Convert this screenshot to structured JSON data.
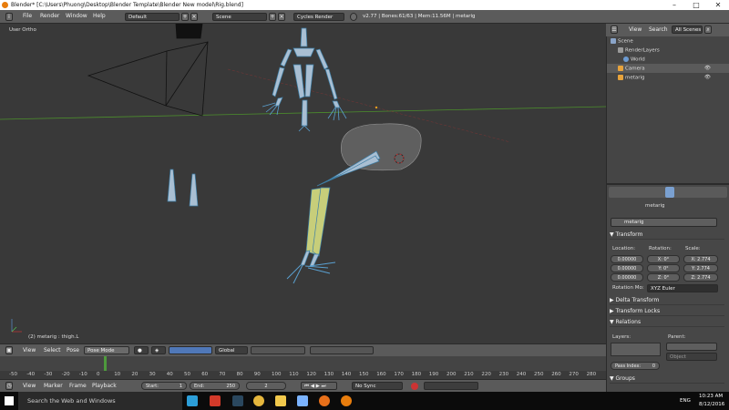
{
  "window": {
    "title": "Blender* [C:\\Users\\Phuong\\Desktop\\Blender Template\\Blender New model\\Rig.blend]",
    "minimize": "–",
    "maximize": "□",
    "close": "✕"
  },
  "menubar": {
    "items": [
      "File",
      "Render",
      "Window",
      "Help"
    ],
    "screen_layout": "Default",
    "scene": "Scene",
    "engine": "Cycles Render",
    "stats": "v2.77 | Bones:61/63 | Mem:11.56M | metarig"
  },
  "viewport": {
    "view_label": "User Ortho",
    "object_label": "(2) metarig : thigh.L"
  },
  "vpheader": {
    "view": "View",
    "select": "Select",
    "pose": "Pose",
    "mode": "Pose Mode",
    "orientation": "Global"
  },
  "timeline": {
    "ticks": [
      "-50",
      "-40",
      "-30",
      "-20",
      "-10",
      "0",
      "10",
      "20",
      "30",
      "40",
      "50",
      "60",
      "70",
      "80",
      "90",
      "100",
      "110",
      "120",
      "130",
      "140",
      "150",
      "160",
      "170",
      "180",
      "190",
      "200",
      "210",
      "220",
      "230",
      "240",
      "250",
      "260",
      "270",
      "280"
    ],
    "current_frame": 2
  },
  "tlbar": {
    "view": "View",
    "marker": "Marker",
    "frame": "Frame",
    "playback": "Playback",
    "start": "Start:",
    "start_val": "1",
    "end": "End:",
    "end_val": "250",
    "frame_val": "2",
    "sync": "No Sync"
  },
  "outliner": {
    "view": "View",
    "search": "Search",
    "scenes": "All Scenes",
    "items": [
      {
        "label": "Scene",
        "color": "#8aa4c8"
      },
      {
        "label": "RenderLayers",
        "color": "#9a9a9a"
      },
      {
        "label": "World",
        "color": "#6c9bd2"
      },
      {
        "label": "Camera",
        "color": "#e7a33c"
      },
      {
        "label": "metarig",
        "color": "#e7a33c"
      }
    ]
  },
  "props": {
    "breadcrumb": "metarig",
    "name": "metarig",
    "transform": "Transform",
    "location": "Location:",
    "rotation": "Rotation:",
    "scale": "Scale:",
    "loc": [
      "0.00000",
      "0.00000",
      "0.00000"
    ],
    "rot": [
      "X:   0°",
      "Y:   0°",
      "Z:   0°"
    ],
    "scl": [
      "X: 2.774",
      "Y: 2.774",
      "Z: 2.774"
    ],
    "rotmode_label": "Rotation Mo:",
    "rotmode": "XYZ Euler",
    "delta": "Delta Transform",
    "locks": "Transform Locks",
    "relations": "Relations",
    "layers": "Layers:",
    "parent": "Parent:",
    "object": "Object",
    "pass_index": "Pass Index:",
    "pass_val": "0",
    "groups": "Groups"
  },
  "taskbar": {
    "search": "Search the Web and Windows",
    "lang": "ENG",
    "time": "10:23 AM",
    "date": "8/12/2016"
  }
}
